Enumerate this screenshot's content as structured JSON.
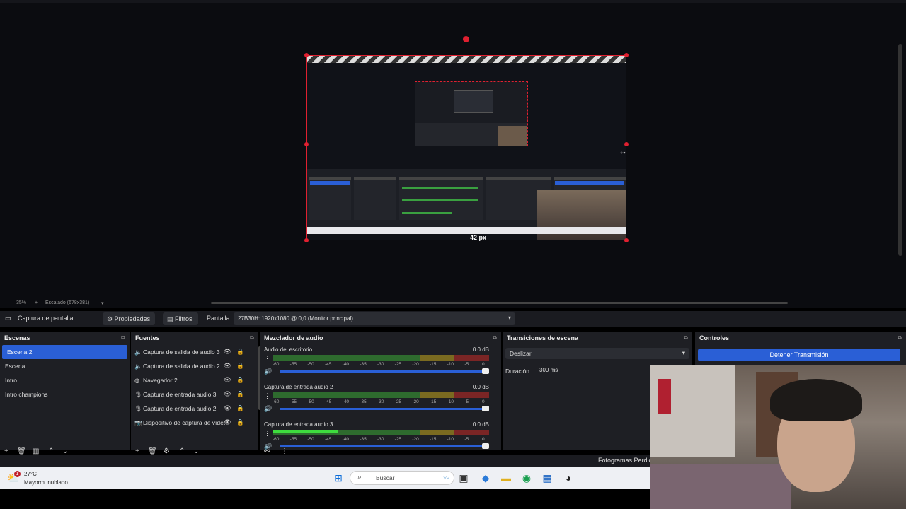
{
  "preview": {
    "px_label": "42 px",
    "zoom": {
      "minus": "–",
      "value": "35%",
      "plus": "+",
      "scaled": "Escalado (678x381)",
      "dropdown": "▾"
    }
  },
  "context_bar": {
    "source_icon": "monitor-icon",
    "source_label": "Captura de pantalla",
    "properties": "Propiedades",
    "filters": "Filtros",
    "display_label": "Pantalla",
    "display_value": "27B30H: 1920x1080 @ 0,0 (Monitor principal)"
  },
  "scenes": {
    "title": "Escenas",
    "items": [
      {
        "label": "Escena 2",
        "selected": true
      },
      {
        "label": "Escena",
        "selected": false
      },
      {
        "label": "Intro",
        "selected": false
      },
      {
        "label": "Intro champions",
        "selected": false
      }
    ]
  },
  "sources": {
    "title": "Fuentes",
    "items": [
      {
        "icon": "speaker-icon",
        "label": "Captura de salida de audio 3"
      },
      {
        "icon": "speaker-icon",
        "label": "Captura de salida de audio 2"
      },
      {
        "icon": "globe-icon",
        "label": "Navegador 2"
      },
      {
        "icon": "microphone-icon",
        "label": "Captura de entrada audio 3"
      },
      {
        "icon": "microphone-icon",
        "label": "Captura de entrada audio 2"
      },
      {
        "icon": "camera-icon",
        "label": "Dispositivo de captura de vídeo"
      }
    ]
  },
  "mixer": {
    "title": "Mezclador de audio",
    "scale": [
      "-60",
      "-55",
      "-50",
      "-45",
      "-40",
      "-35",
      "-30",
      "-25",
      "-20",
      "-15",
      "-10",
      "-5",
      "0"
    ],
    "channels": [
      {
        "name": "Audio del escritorio",
        "db": "0.0 dB",
        "level": 0
      },
      {
        "name": "Captura de entrada audio 2",
        "db": "0.0 dB",
        "level": 0
      },
      {
        "name": "Captura de entrada audio 3",
        "db": "0.0 dB",
        "level": 0.3
      }
    ]
  },
  "transitions": {
    "title": "Transiciones de escena",
    "selected": "Deslizar",
    "duration_label": "Duración",
    "duration_value": "300 ms"
  },
  "controls": {
    "title": "Controles",
    "stream_button": "Detener Transmisión"
  },
  "status_bar": {
    "dropped_frames": "Fotogramas Perdidos"
  },
  "taskbar": {
    "temperature": "27°C",
    "weather": "Mayorm. nublado",
    "badge": "1",
    "search_placeholder": "Buscar"
  },
  "colors": {
    "accent": "#2a5fd6",
    "selection_border": "#e02030"
  }
}
